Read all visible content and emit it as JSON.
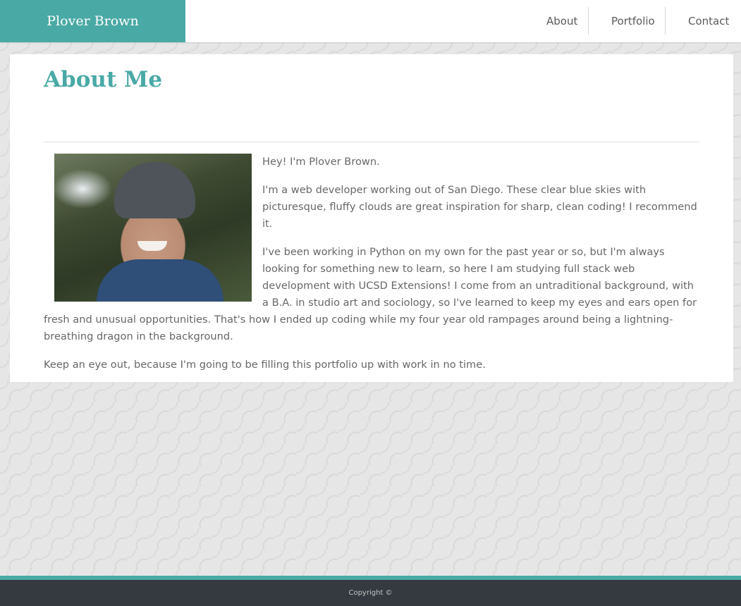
{
  "header": {
    "brand": "Plover Brown",
    "nav": [
      "About",
      "Portfolio",
      "Contact"
    ]
  },
  "main": {
    "title": "About Me",
    "paragraphs": [
      "Hey! I'm Plover Brown.",
      "I'm a web developer working out of San Diego. These clear blue skies with picturesque, fluffy clouds are great inspiration for sharp, clean coding! I recommend it.",
      "I've been working in Python on my own for the past year or so, but I'm always looking for something new to learn, so here I am studying full stack web development with UCSD Extensions! I come from an untraditional background, with a B.A. in studio art and sociology, so I've learned to keep my eyes and ears open for fresh and unusual opportunities. That's how I ended up coding while my four year old rampages around being a lightning-breathing dragon in the background.",
      "Keep an eye out, because I'm going to be filling this portfolio up with work in no time."
    ]
  },
  "footer": {
    "copyright": "Copyright ©"
  },
  "colors": {
    "accent": "#49a9a5",
    "footer_bg": "#343a40",
    "text": "#676767"
  }
}
